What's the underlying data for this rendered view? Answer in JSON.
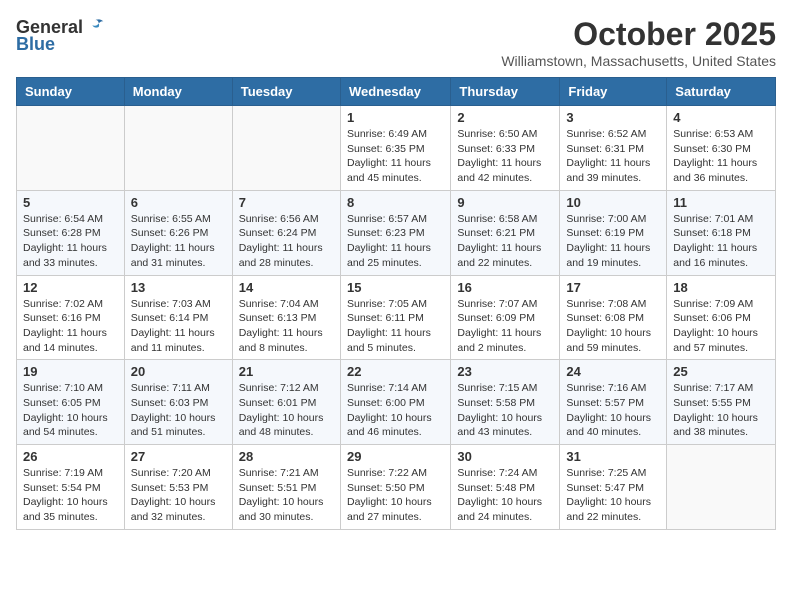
{
  "header": {
    "logo_general": "General",
    "logo_blue": "Blue",
    "month_title": "October 2025",
    "location": "Williamstown, Massachusetts, United States"
  },
  "weekdays": [
    "Sunday",
    "Monday",
    "Tuesday",
    "Wednesday",
    "Thursday",
    "Friday",
    "Saturday"
  ],
  "weeks": [
    [
      {
        "day": "",
        "info": ""
      },
      {
        "day": "",
        "info": ""
      },
      {
        "day": "",
        "info": ""
      },
      {
        "day": "1",
        "info": "Sunrise: 6:49 AM\nSunset: 6:35 PM\nDaylight: 11 hours and 45 minutes."
      },
      {
        "day": "2",
        "info": "Sunrise: 6:50 AM\nSunset: 6:33 PM\nDaylight: 11 hours and 42 minutes."
      },
      {
        "day": "3",
        "info": "Sunrise: 6:52 AM\nSunset: 6:31 PM\nDaylight: 11 hours and 39 minutes."
      },
      {
        "day": "4",
        "info": "Sunrise: 6:53 AM\nSunset: 6:30 PM\nDaylight: 11 hours and 36 minutes."
      }
    ],
    [
      {
        "day": "5",
        "info": "Sunrise: 6:54 AM\nSunset: 6:28 PM\nDaylight: 11 hours and 33 minutes."
      },
      {
        "day": "6",
        "info": "Sunrise: 6:55 AM\nSunset: 6:26 PM\nDaylight: 11 hours and 31 minutes."
      },
      {
        "day": "7",
        "info": "Sunrise: 6:56 AM\nSunset: 6:24 PM\nDaylight: 11 hours and 28 minutes."
      },
      {
        "day": "8",
        "info": "Sunrise: 6:57 AM\nSunset: 6:23 PM\nDaylight: 11 hours and 25 minutes."
      },
      {
        "day": "9",
        "info": "Sunrise: 6:58 AM\nSunset: 6:21 PM\nDaylight: 11 hours and 22 minutes."
      },
      {
        "day": "10",
        "info": "Sunrise: 7:00 AM\nSunset: 6:19 PM\nDaylight: 11 hours and 19 minutes."
      },
      {
        "day": "11",
        "info": "Sunrise: 7:01 AM\nSunset: 6:18 PM\nDaylight: 11 hours and 16 minutes."
      }
    ],
    [
      {
        "day": "12",
        "info": "Sunrise: 7:02 AM\nSunset: 6:16 PM\nDaylight: 11 hours and 14 minutes."
      },
      {
        "day": "13",
        "info": "Sunrise: 7:03 AM\nSunset: 6:14 PM\nDaylight: 11 hours and 11 minutes."
      },
      {
        "day": "14",
        "info": "Sunrise: 7:04 AM\nSunset: 6:13 PM\nDaylight: 11 hours and 8 minutes."
      },
      {
        "day": "15",
        "info": "Sunrise: 7:05 AM\nSunset: 6:11 PM\nDaylight: 11 hours and 5 minutes."
      },
      {
        "day": "16",
        "info": "Sunrise: 7:07 AM\nSunset: 6:09 PM\nDaylight: 11 hours and 2 minutes."
      },
      {
        "day": "17",
        "info": "Sunrise: 7:08 AM\nSunset: 6:08 PM\nDaylight: 10 hours and 59 minutes."
      },
      {
        "day": "18",
        "info": "Sunrise: 7:09 AM\nSunset: 6:06 PM\nDaylight: 10 hours and 57 minutes."
      }
    ],
    [
      {
        "day": "19",
        "info": "Sunrise: 7:10 AM\nSunset: 6:05 PM\nDaylight: 10 hours and 54 minutes."
      },
      {
        "day": "20",
        "info": "Sunrise: 7:11 AM\nSunset: 6:03 PM\nDaylight: 10 hours and 51 minutes."
      },
      {
        "day": "21",
        "info": "Sunrise: 7:12 AM\nSunset: 6:01 PM\nDaylight: 10 hours and 48 minutes."
      },
      {
        "day": "22",
        "info": "Sunrise: 7:14 AM\nSunset: 6:00 PM\nDaylight: 10 hours and 46 minutes."
      },
      {
        "day": "23",
        "info": "Sunrise: 7:15 AM\nSunset: 5:58 PM\nDaylight: 10 hours and 43 minutes."
      },
      {
        "day": "24",
        "info": "Sunrise: 7:16 AM\nSunset: 5:57 PM\nDaylight: 10 hours and 40 minutes."
      },
      {
        "day": "25",
        "info": "Sunrise: 7:17 AM\nSunset: 5:55 PM\nDaylight: 10 hours and 38 minutes."
      }
    ],
    [
      {
        "day": "26",
        "info": "Sunrise: 7:19 AM\nSunset: 5:54 PM\nDaylight: 10 hours and 35 minutes."
      },
      {
        "day": "27",
        "info": "Sunrise: 7:20 AM\nSunset: 5:53 PM\nDaylight: 10 hours and 32 minutes."
      },
      {
        "day": "28",
        "info": "Sunrise: 7:21 AM\nSunset: 5:51 PM\nDaylight: 10 hours and 30 minutes."
      },
      {
        "day": "29",
        "info": "Sunrise: 7:22 AM\nSunset: 5:50 PM\nDaylight: 10 hours and 27 minutes."
      },
      {
        "day": "30",
        "info": "Sunrise: 7:24 AM\nSunset: 5:48 PM\nDaylight: 10 hours and 24 minutes."
      },
      {
        "day": "31",
        "info": "Sunrise: 7:25 AM\nSunset: 5:47 PM\nDaylight: 10 hours and 22 minutes."
      },
      {
        "day": "",
        "info": ""
      }
    ]
  ]
}
